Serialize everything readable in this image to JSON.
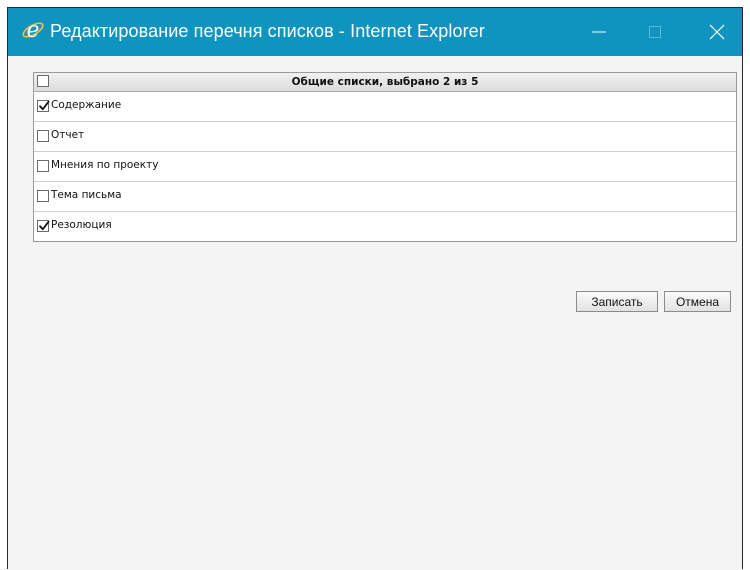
{
  "window": {
    "title": "Редактирование перечня списков - Internet Explorer",
    "titlebar_color": "#0f94bf"
  },
  "titlebar_controls": {
    "minimize_icon": "minimize-icon",
    "maximize_icon": "maximize-icon",
    "close_icon": "close-icon"
  },
  "list": {
    "header": "Общие списки, выбрано 2 из 5",
    "header_checked": false,
    "items": [
      {
        "label": "Содержание",
        "checked": true
      },
      {
        "label": "Отчет",
        "checked": false
      },
      {
        "label": "Мнения по проекту",
        "checked": false
      },
      {
        "label": "Тема письма",
        "checked": false
      },
      {
        "label": "Резолюция",
        "checked": true
      }
    ]
  },
  "buttons": {
    "save_label": "Записать",
    "cancel_label": "Отмена"
  }
}
